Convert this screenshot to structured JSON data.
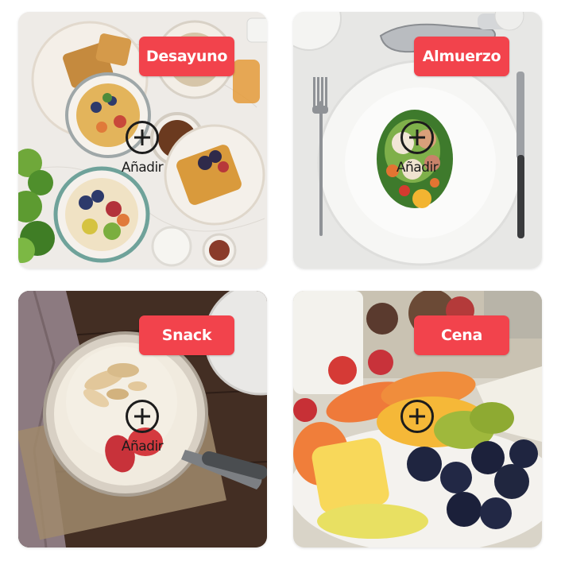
{
  "colors": {
    "accent": "#f2434c",
    "icon": "#1c1c1c"
  },
  "meals": [
    {
      "label": "Desayuno",
      "add_label": "Añadir",
      "image": "breakfast-photo"
    },
    {
      "label": "Almuerzo",
      "add_label": "Añadir",
      "image": "lunch-photo"
    },
    {
      "label": "Snack",
      "add_label": "Añadir",
      "image": "snack-photo"
    },
    {
      "label": "Cena",
      "add_label": "",
      "image": "dinner-photo"
    }
  ]
}
